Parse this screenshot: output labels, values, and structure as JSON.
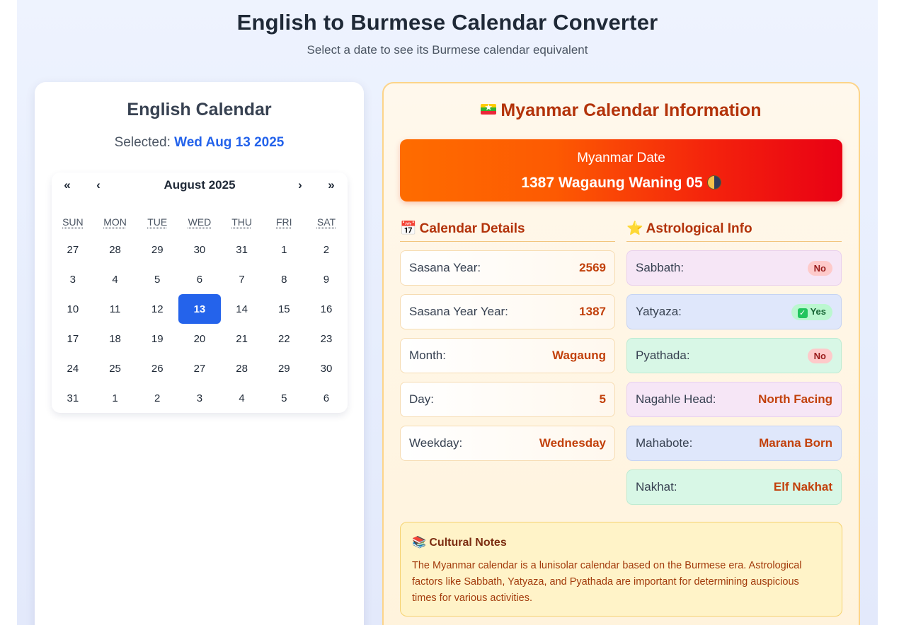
{
  "header": {
    "title": "English to Burmese Calendar Converter",
    "subtitle": "Select a date to see its Burmese calendar equivalent"
  },
  "english_calendar": {
    "title": "English Calendar",
    "selected_label": "Selected:",
    "selected_value": "Wed Aug 13 2025",
    "nav": {
      "prev_year": "«",
      "prev_month": "‹",
      "next_month": "›",
      "next_year": "»"
    },
    "month_label": "August 2025",
    "weekdays": [
      "SUN",
      "MON",
      "TUE",
      "WED",
      "THU",
      "FRI",
      "SAT"
    ],
    "days": [
      "27",
      "28",
      "29",
      "30",
      "31",
      "1",
      "2",
      "3",
      "4",
      "5",
      "6",
      "7",
      "8",
      "9",
      "10",
      "11",
      "12",
      "13",
      "14",
      "15",
      "16",
      "17",
      "18",
      "19",
      "20",
      "21",
      "22",
      "23",
      "24",
      "25",
      "26",
      "27",
      "28",
      "29",
      "30",
      "31",
      "1",
      "2",
      "3",
      "4",
      "5",
      "6"
    ],
    "selected_day_index": 17
  },
  "myanmar_info": {
    "title": "Myanmar Calendar Information",
    "flag_icon": "myanmar-flag",
    "banner": {
      "label": "Myanmar Date",
      "value": "1387 Wagaung Waning 05",
      "moon_icon": "waning-moon"
    },
    "calendar_details": {
      "heading": "Calendar Details",
      "icon": "📅",
      "rows": [
        {
          "label": "Sasana Year:",
          "value": "2569"
        },
        {
          "label": "Sasana Year Year:",
          "value": "1387"
        },
        {
          "label": "Month:",
          "value": "Wagaung"
        },
        {
          "label": "Day:",
          "value": "5"
        },
        {
          "label": "Weekday:",
          "value": "Wednesday"
        }
      ]
    },
    "astrological_info": {
      "heading": "Astrological Info",
      "icon": "⭐",
      "rows": [
        {
          "label": "Sabbath:",
          "value": "No"
        },
        {
          "label": "Yatyaza:",
          "value": "Yes"
        },
        {
          "label": "Pyathada:",
          "value": "No"
        },
        {
          "label": "Nagahle Head:",
          "value": "North Facing"
        },
        {
          "label": "Mahabote:",
          "value": "Marana Born"
        },
        {
          "label": "Nakhat:",
          "value": "Elf Nakhat"
        }
      ]
    },
    "cultural_notes": {
      "icon": "📚",
      "title": "Cultural Notes",
      "text": "The Myanmar calendar is a lunisolar calendar based on the Burmese era. Astrological factors like Sabbath, Yatyaza, and Pyathada are important for determining auspicious times for various activities."
    }
  },
  "colors": {
    "accent": "#2463eb",
    "myanmar_title": "#b3330a",
    "banner_start": "#fe6c00",
    "banner_end": "#e90014"
  }
}
